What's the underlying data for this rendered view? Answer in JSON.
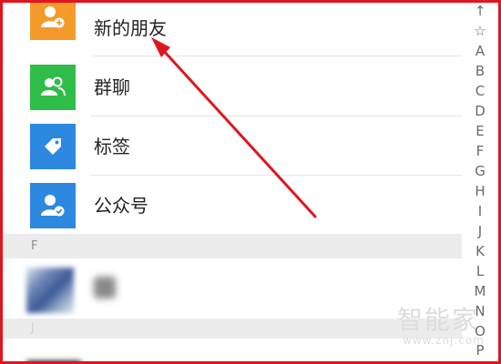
{
  "menu": [
    {
      "label": "新的朋友",
      "icon": "add-friend-icon",
      "color": "#f39a2b"
    },
    {
      "label": "群聊",
      "icon": "group-chat-icon",
      "color": "#2fbd49"
    },
    {
      "label": "标签",
      "icon": "tag-icon",
      "color": "#2d88e0"
    },
    {
      "label": "公众号",
      "icon": "official-account-icon",
      "color": "#2d88e0"
    }
  ],
  "sections": [
    {
      "letter": "F"
    },
    {
      "letter": "J"
    }
  ],
  "index": [
    "↑",
    "☆",
    "A",
    "B",
    "C",
    "D",
    "E",
    "F",
    "G",
    "H",
    "I",
    "J",
    "K",
    "L",
    "M",
    "N",
    "O",
    "P"
  ],
  "watermark": {
    "name": "智能家",
    "url": "www.znj.com"
  },
  "annotation": {
    "color": "#e0161e",
    "frame": "red-border",
    "arrow": "red-arrow"
  }
}
